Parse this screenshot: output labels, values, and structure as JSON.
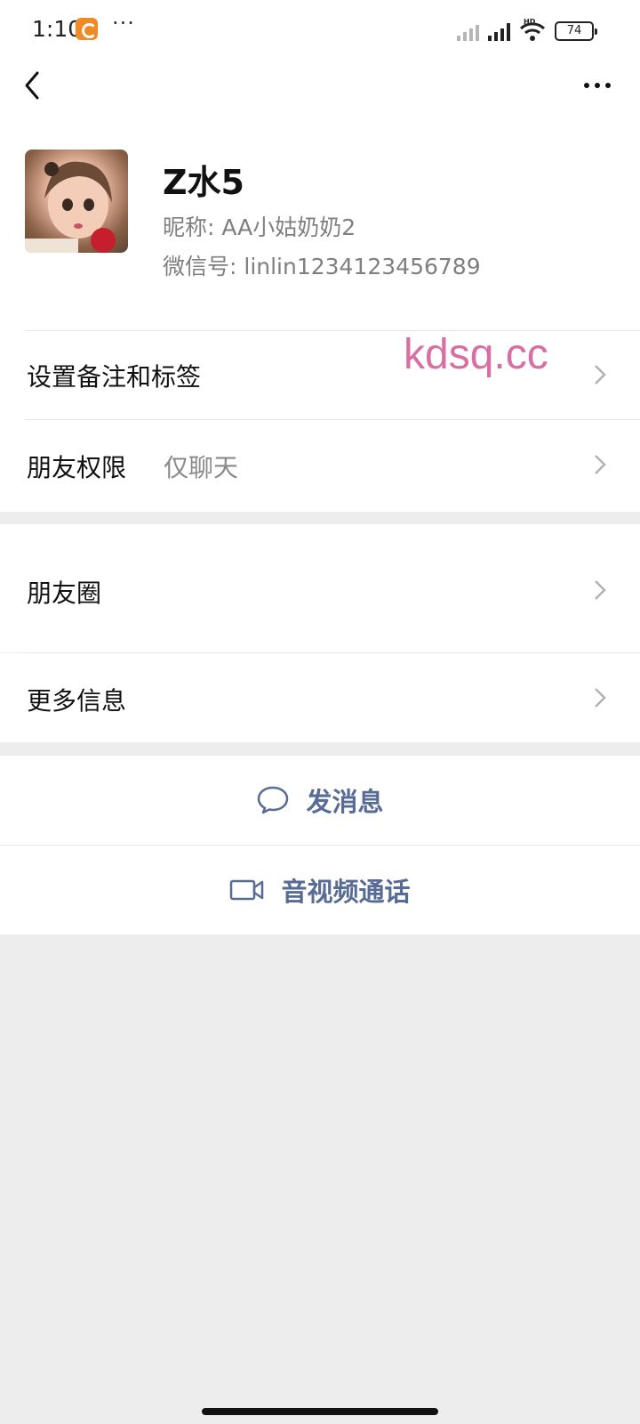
{
  "status_bar": {
    "time": "1:10",
    "dots": "···",
    "battery": "74",
    "network_tag": "HD"
  },
  "profile": {
    "name": "Z水5",
    "nickname": "昵称: AA小姑奶奶2",
    "wechat_id": "微信号: linlin1234123456789"
  },
  "watermark": "kdsq.cc",
  "rows": {
    "remarks_tags": "设置备注和标签",
    "friend_permissions": "朋友权限",
    "friend_permissions_value": "仅聊天",
    "moments": "朋友圈",
    "more_info": "更多信息"
  },
  "actions": {
    "send_message": "发消息",
    "av_call": "音视频通话"
  },
  "colors": {
    "accent": "#576b95",
    "background": "#ededed",
    "watermark": "#d76ea4"
  },
  "icons": [
    "back-arrow-icon",
    "more-dots-icon",
    "chevron-right-icon",
    "chat-bubble-icon",
    "video-camera-icon"
  ]
}
